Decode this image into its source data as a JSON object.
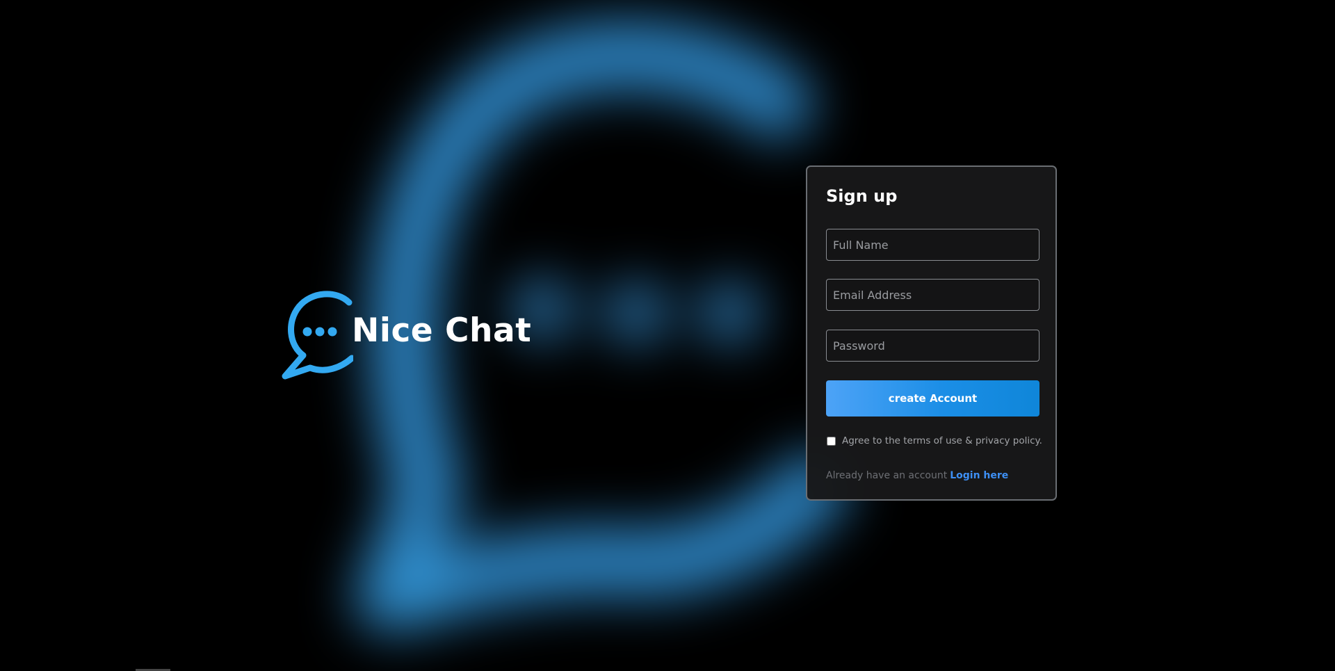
{
  "brand": {
    "name": "Nice Chat",
    "logo_icon": "chat-bubble-dots-icon",
    "accent_color": "#33a9f1"
  },
  "signup": {
    "title": "Sign up",
    "full_name_placeholder": "Full Name",
    "email_placeholder": "Email Address",
    "password_placeholder": "Password",
    "submit_label": "create Account",
    "terms_label": "Agree to the terms of use & privacy policy.",
    "terms_checked": false,
    "login_prompt": "Already have an account",
    "login_link_label": "Login here"
  },
  "colors": {
    "background": "#000000",
    "glow": "#2e8ed0",
    "button_start": "#4da3f7",
    "button_end": "#0f86d9",
    "link": "#3d8ff4"
  }
}
